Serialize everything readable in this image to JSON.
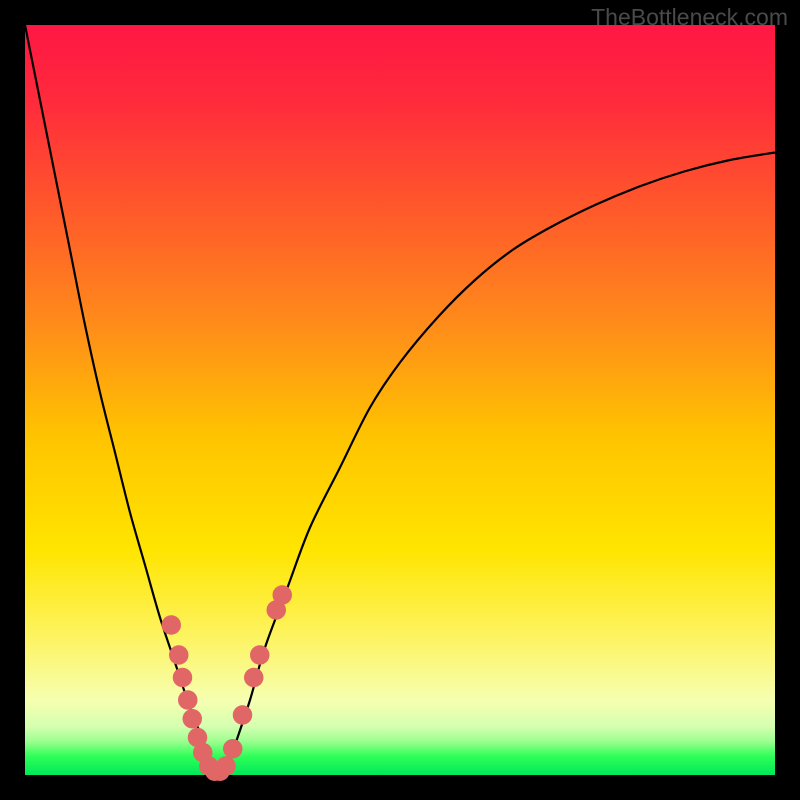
{
  "watermark": "TheBottleneck.com",
  "gradient_stops": [
    {
      "offset": 0.0,
      "color": "#ff1744"
    },
    {
      "offset": 0.1,
      "color": "#ff2a3c"
    },
    {
      "offset": 0.25,
      "color": "#ff5a2a"
    },
    {
      "offset": 0.4,
      "color": "#ff8c1a"
    },
    {
      "offset": 0.55,
      "color": "#ffc400"
    },
    {
      "offset": 0.7,
      "color": "#ffe500"
    },
    {
      "offset": 0.82,
      "color": "#fdf465"
    },
    {
      "offset": 0.9,
      "color": "#f6ffb0"
    },
    {
      "offset": 0.935,
      "color": "#d6ffb0"
    },
    {
      "offset": 0.955,
      "color": "#9cff90"
    },
    {
      "offset": 0.975,
      "color": "#2eff57"
    },
    {
      "offset": 1.0,
      "color": "#00e85a"
    }
  ],
  "chart_data": {
    "type": "line",
    "title": "",
    "xlabel": "",
    "ylabel": "",
    "xlim": [
      0,
      100
    ],
    "ylim": [
      0,
      100
    ],
    "series": [
      {
        "name": "bottleneck-curve",
        "x": [
          0,
          2,
          4,
          6,
          8,
          10,
          12,
          14,
          16,
          18,
          20,
          22,
          24,
          25,
          26,
          27,
          28,
          30,
          32,
          35,
          38,
          42,
          46,
          50,
          55,
          60,
          65,
          70,
          76,
          82,
          88,
          94,
          100
        ],
        "y": [
          100,
          90,
          80,
          70,
          60,
          51,
          43,
          35,
          28,
          21,
          15,
          9,
          4,
          1,
          0,
          1,
          4,
          10,
          17,
          25,
          33,
          41,
          49,
          55,
          61,
          66,
          70,
          73,
          76,
          78.5,
          80.5,
          82,
          83
        ]
      }
    ],
    "markers": {
      "name": "highlighted-points",
      "color": "#e16767",
      "radius": 1.3,
      "points": [
        {
          "x": 19.5,
          "y": 20
        },
        {
          "x": 20.5,
          "y": 16
        },
        {
          "x": 21.0,
          "y": 13
        },
        {
          "x": 21.7,
          "y": 10
        },
        {
          "x": 22.3,
          "y": 7.5
        },
        {
          "x": 23.0,
          "y": 5
        },
        {
          "x": 23.7,
          "y": 3
        },
        {
          "x": 24.5,
          "y": 1.2
        },
        {
          "x": 25.3,
          "y": 0.5
        },
        {
          "x": 26.0,
          "y": 0.5
        },
        {
          "x": 26.8,
          "y": 1.2
        },
        {
          "x": 27.7,
          "y": 3.5
        },
        {
          "x": 29.0,
          "y": 8
        },
        {
          "x": 30.5,
          "y": 13
        },
        {
          "x": 31.3,
          "y": 16
        },
        {
          "x": 33.5,
          "y": 22
        },
        {
          "x": 34.3,
          "y": 24
        }
      ]
    }
  }
}
